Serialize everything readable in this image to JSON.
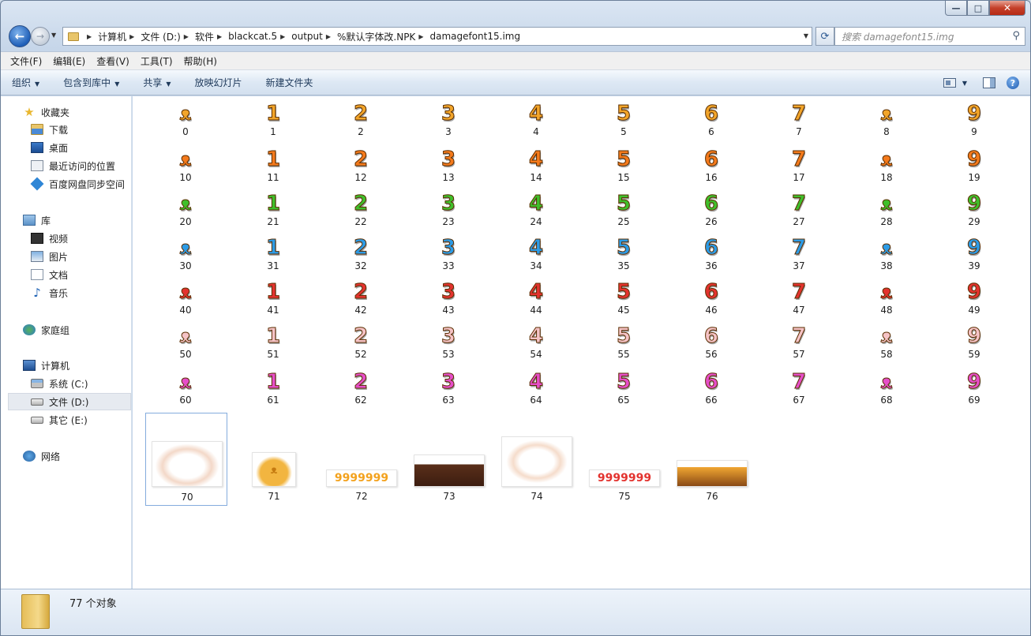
{
  "window": {
    "controls": {
      "minimize": "—",
      "maximize": "□",
      "close": "✕"
    }
  },
  "nav": {
    "back": "←",
    "forward": "→"
  },
  "address": {
    "crumbs": [
      "计算机",
      "文件 (D:)",
      "软件",
      "blackcat.5",
      "output",
      "%默认字体改.NPK",
      "damagefont15.img"
    ]
  },
  "search": {
    "placeholder": "搜索 damagefont15.img"
  },
  "menubar": [
    "文件(F)",
    "编辑(E)",
    "查看(V)",
    "工具(T)",
    "帮助(H)"
  ],
  "commandbar": [
    "组织",
    "包含到库中",
    "共享",
    "放映幻灯片",
    "新建文件夹"
  ],
  "sidebar": {
    "favorites": {
      "label": "收藏夹",
      "items": [
        "下载",
        "桌面",
        "最近访问的位置",
        "百度网盘同步空间"
      ]
    },
    "libraries": {
      "label": "库",
      "items": [
        "视频",
        "图片",
        "文档",
        "音乐"
      ]
    },
    "homegroup": "家庭组",
    "computer": {
      "label": "计算机",
      "items": [
        "系统 (C:)",
        "文件 (D:)",
        "其它 (E:)"
      ]
    },
    "network": "网络"
  },
  "rows": [
    {
      "color": "#f2a52a",
      "labels": [
        "0",
        "1",
        "2",
        "3",
        "4",
        "5",
        "6",
        "7",
        "8",
        "9"
      ]
    },
    {
      "color": "#f47a1c",
      "labels": [
        "10",
        "11",
        "12",
        "13",
        "14",
        "15",
        "16",
        "17",
        "18",
        "19"
      ]
    },
    {
      "color": "#3fbf2b",
      "labels": [
        "20",
        "21",
        "22",
        "23",
        "24",
        "25",
        "26",
        "27",
        "28",
        "29"
      ]
    },
    {
      "color": "#2c9be6",
      "labels": [
        "30",
        "31",
        "32",
        "33",
        "34",
        "35",
        "36",
        "37",
        "38",
        "39"
      ]
    },
    {
      "color": "#e3332f",
      "labels": [
        "40",
        "41",
        "42",
        "43",
        "44",
        "45",
        "46",
        "47",
        "48",
        "49"
      ]
    },
    {
      "color": "#f5c3c6",
      "labels": [
        "50",
        "51",
        "52",
        "53",
        "54",
        "55",
        "56",
        "57",
        "58",
        "59"
      ]
    },
    {
      "color": "#e64ec9",
      "labels": [
        "60",
        "61",
        "62",
        "63",
        "64",
        "65",
        "66",
        "67",
        "68",
        "69"
      ]
    }
  ],
  "glyphs": [
    "ᴥ",
    "1",
    "2",
    "3",
    "4",
    "5",
    "6",
    "7",
    "ᴥ",
    "9"
  ],
  "big_items": [
    {
      "label": "70",
      "thumb_text": "",
      "selected": true
    },
    {
      "label": "71",
      "thumb_text": "ᴥ"
    },
    {
      "label": "72",
      "thumb_text": "9999999"
    },
    {
      "label": "73",
      "thumb_text": ""
    },
    {
      "label": "74",
      "thumb_text": ""
    },
    {
      "label": "75",
      "thumb_text": "9999999"
    },
    {
      "label": "76",
      "thumb_text": ""
    }
  ],
  "status": {
    "count": "77 个对象"
  }
}
